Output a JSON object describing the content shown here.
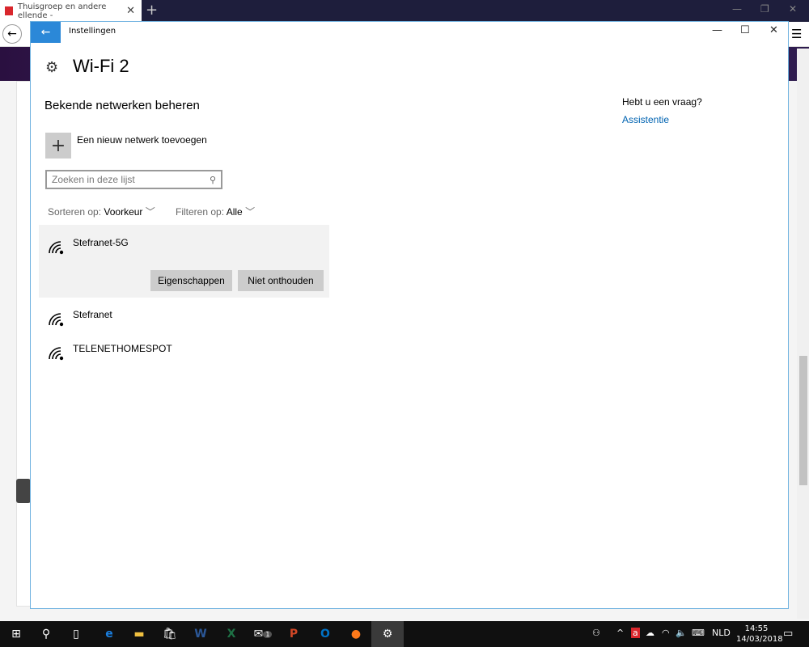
{
  "browser": {
    "tab_title": "Thuisgroep en andere ellende -",
    "new_tab": "+",
    "menu": "☰"
  },
  "window": {
    "title": "Instellingen",
    "page_title": "Wi-Fi 2",
    "minimize": "—",
    "maximize": "☐",
    "close": "✕"
  },
  "main": {
    "section_title": "Bekende netwerken beheren",
    "add_network_label": "Een nieuw netwerk toevoegen",
    "search_placeholder": "Zoeken in deze lijst",
    "sort_label": "Sorteren op:",
    "sort_value": "Voorkeur",
    "filter_label": "Filteren op:",
    "filter_value": "Alle",
    "networks": [
      {
        "name": "Stefranet-5G",
        "selected": true
      },
      {
        "name": "Stefranet"
      },
      {
        "name": "TELENETHOMESPOT"
      }
    ],
    "properties_button": "Eigenschappen",
    "forget_button": "Niet onthouden"
  },
  "help": {
    "question": "Hebt u een vraag?",
    "link": "Assistentie"
  },
  "taskbar": {
    "apps": [
      "start",
      "search",
      "task-view",
      "edge",
      "file-explorer",
      "store",
      "word",
      "excel",
      "mail",
      "powerpoint",
      "outlook",
      "firefox",
      "settings"
    ],
    "mail_badge": "1",
    "language": "NLD",
    "time": "14:55",
    "date": "14/03/2018"
  },
  "colors": {
    "accent": "#2b88d8",
    "link": "#0063b1"
  }
}
